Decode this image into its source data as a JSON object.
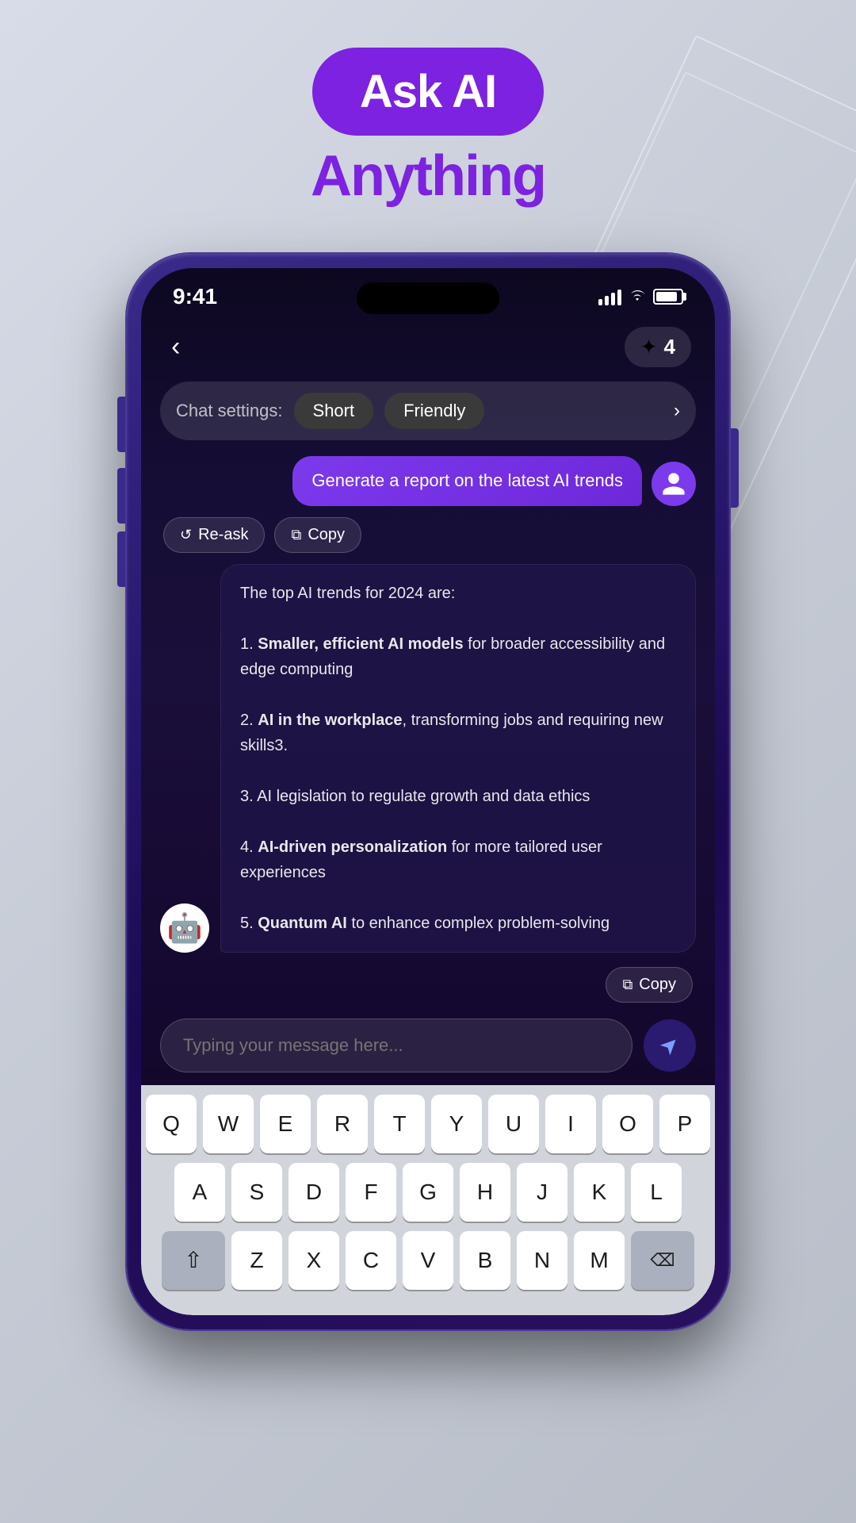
{
  "header": {
    "badge_text": "Ask AI",
    "subtitle": "Anything"
  },
  "phone": {
    "status_bar": {
      "time": "9:41",
      "credits": "4"
    },
    "chat_settings": {
      "label": "Chat settings:",
      "chip1": "Short",
      "chip2": "Friendly"
    },
    "user_message": {
      "text": "Generate a report on the latest AI trends"
    },
    "action_buttons": {
      "reask": "Re-ask",
      "copy": "Copy"
    },
    "ai_response": {
      "intro": "The top AI trends for 2024 are:",
      "items": [
        {
          "number": "1.",
          "bold": "Smaller, efficient AI models",
          "rest": " for broader accessibility and edge computing"
        },
        {
          "number": "2.",
          "bold": "AI in the workplace",
          "rest": ", transforming jobs and requiring new skills3."
        },
        {
          "number": "3.",
          "bold": "",
          "rest": "AI legislation to regulate growth and data ethics"
        },
        {
          "number": "4.",
          "bold": "AI-driven personalization",
          "rest": " for more tailored user experiences"
        },
        {
          "number": "5.",
          "bold": "Quantum AI",
          "rest": " to enhance complex problem-solving"
        }
      ]
    },
    "copy_button": "Copy",
    "input": {
      "placeholder": "Typing your message here..."
    },
    "keyboard": {
      "row1": [
        "Q",
        "W",
        "E",
        "R",
        "T",
        "Y",
        "U",
        "I",
        "O",
        "P"
      ],
      "row2": [
        "A",
        "S",
        "D",
        "F",
        "G",
        "H",
        "J",
        "K",
        "L"
      ],
      "row3": [
        "Z",
        "X",
        "C",
        "V",
        "B",
        "N",
        "M"
      ]
    }
  }
}
